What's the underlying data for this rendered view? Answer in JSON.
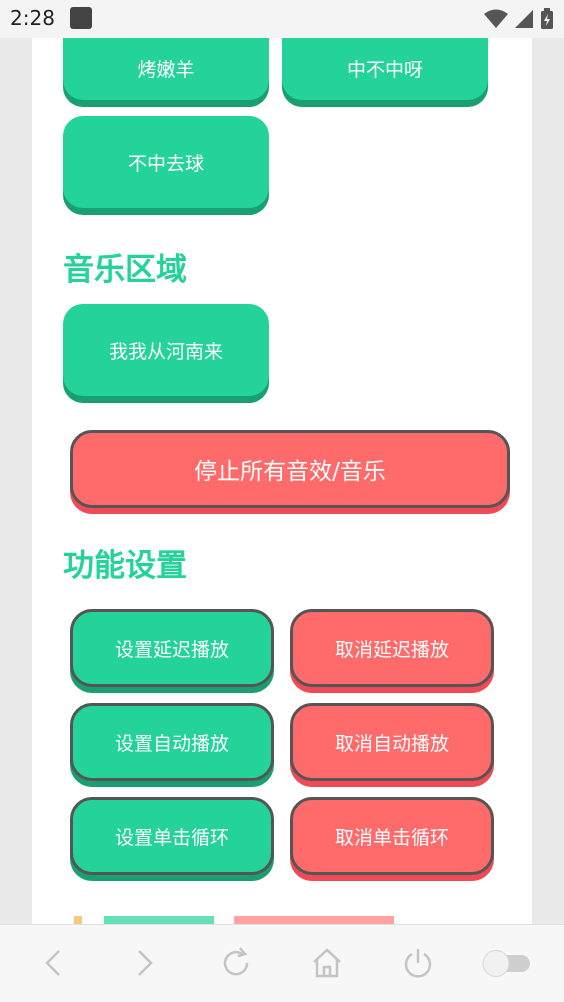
{
  "status_bar": {
    "time": "2:28"
  },
  "sound_buttons": [
    {
      "label": "烤嫩羊"
    },
    {
      "label": "中不中呀"
    },
    {
      "label": "不中去球"
    }
  ],
  "music_section": {
    "title": "音乐区域",
    "buttons": [
      {
        "label": "我我从河南来"
      }
    ]
  },
  "stop_button": {
    "label": "停止所有音效/音乐"
  },
  "function_section": {
    "title": "功能设置",
    "buttons": [
      {
        "label": "设置延迟播放"
      },
      {
        "label": "取消延迟播放"
      },
      {
        "label": "设置自动播放"
      },
      {
        "label": "取消自动播放"
      },
      {
        "label": "设置单击循环"
      },
      {
        "label": "取消单击循环"
      }
    ]
  },
  "nav_bar": {
    "icons": [
      "back-icon",
      "forward-icon",
      "refresh-icon",
      "home-icon",
      "power-icon",
      "toggle-switch"
    ]
  },
  "colors": {
    "accent_green": "#23d399",
    "accent_red": "#ff6b6b"
  }
}
